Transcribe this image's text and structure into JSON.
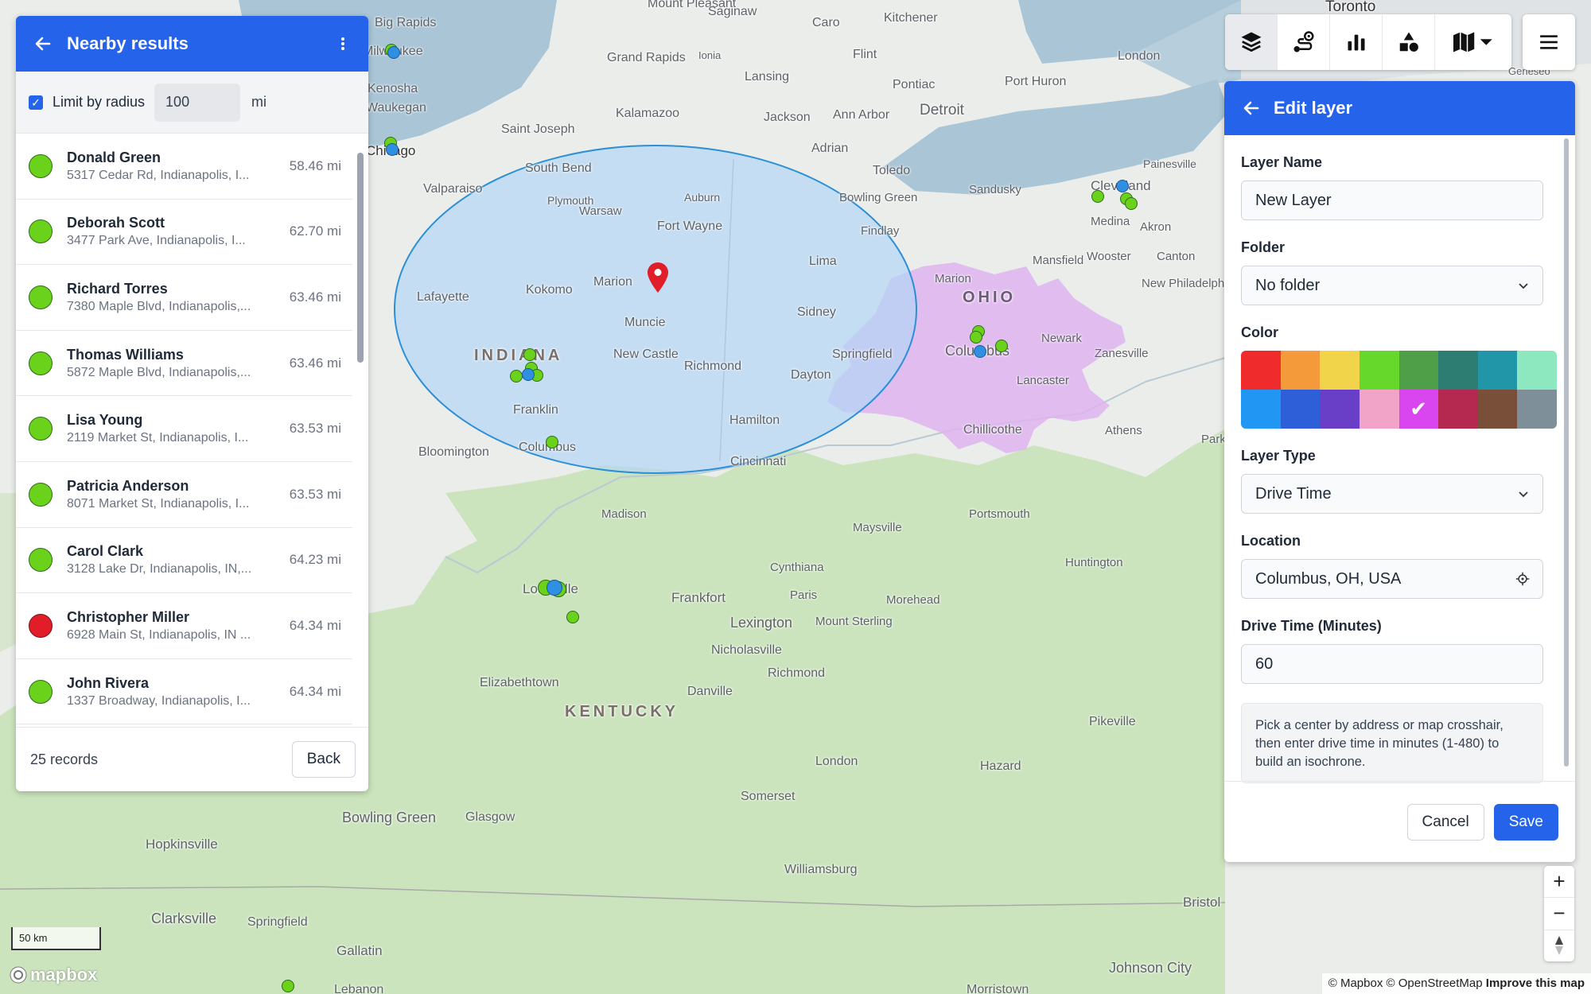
{
  "colors": {
    "accent": "#2563eb",
    "status_ok": "#6ad21b",
    "status_bad": "#e11d2a",
    "radius_fill": "#b3d6f5",
    "isochrone_fill": "#dfb3f0"
  },
  "map": {
    "places": [
      "Big Rapids",
      "Mount Pleasant",
      "Saginaw",
      "Caro",
      "Kitchener",
      "Toronto",
      "Milwaukee",
      "Grand Rapids",
      "Ionia",
      "Flint",
      "London",
      "Port Huron",
      "Lansing",
      "Pontiac",
      "Kenosha",
      "Waukegan",
      "Detroit",
      "Kalamazoo",
      "Jackson",
      "Ann Arbor",
      "Saint Joseph",
      "Adrian",
      "Chicago",
      "South Bend",
      "Toledo",
      "Painesville",
      "Valparaiso",
      "Plymouth",
      "Auburn",
      "Bowling Green",
      "Sandusky",
      "Cleveland",
      "Warsaw",
      "Fort Wayne",
      "Findlay",
      "Medina",
      "Akron",
      "Lima",
      "Mansfield",
      "Wooster",
      "Canton",
      "Marion",
      "New Philadelphia",
      "Lafayette",
      "Kokomo",
      "Marion",
      "Sidney",
      "Muncie",
      "Newark",
      "Zanesville",
      "New Castle",
      "Springfield",
      "Columbus",
      "Richmond",
      "Dayton",
      "Lancaster",
      "Franklin",
      "Hamilton",
      "Chillicothe",
      "Athens",
      "Parkersburg",
      "Bloomington",
      "Columbus",
      "Cincinnati",
      "Madison",
      "Maysville",
      "Portsmouth",
      "Huntington",
      "Cynthiana",
      "Louisville",
      "Frankfort",
      "Paris",
      "Morehead",
      "Lexington",
      "Mount Sterling",
      "Nicholasville",
      "Richmond",
      "Elizabethtown",
      "Danville",
      "Pikeville",
      "Hazard",
      "London",
      "Somerset",
      "Bowling Green",
      "Glasgow",
      "Hopkinsville",
      "Williamsburg",
      "Bristol",
      "Clarksville",
      "Springfield",
      "Gallatin",
      "Johnson City",
      "Lebanon",
      "Morristown",
      "Geneseo"
    ],
    "state_labels": [
      "INDIANA",
      "OHIO",
      "KENTUCKY"
    ],
    "scale_label": "50 km",
    "logo_text": "mapbox",
    "attribution_1": "© Mapbox",
    "attribution_2": "© OpenStreetMap",
    "attribution_3": "Improve this map"
  },
  "toolbar": {
    "tools": [
      "layers-icon",
      "route-icon",
      "bar-chart-icon",
      "shapes-icon",
      "map-style-icon"
    ],
    "menu": "hamburger-icon"
  },
  "nearby": {
    "title": "Nearby results",
    "limit_label": "Limit by radius",
    "radius_value": "100",
    "radius_unit": "mi",
    "records": [
      {
        "name": "Donald Green",
        "address": "5317 Cedar Rd, Indianapolis, I...",
        "distance": "58.46 mi",
        "status": "ok"
      },
      {
        "name": "Deborah Scott",
        "address": "3477 Park Ave, Indianapolis, I...",
        "distance": "62.70 mi",
        "status": "ok"
      },
      {
        "name": "Richard Torres",
        "address": "7380 Maple Blvd, Indianapolis,...",
        "distance": "63.46 mi",
        "status": "ok"
      },
      {
        "name": "Thomas Williams",
        "address": "5872 Maple Blvd, Indianapolis,...",
        "distance": "63.46 mi",
        "status": "ok"
      },
      {
        "name": "Lisa Young",
        "address": "2119 Market St, Indianapolis, I...",
        "distance": "63.53 mi",
        "status": "ok"
      },
      {
        "name": "Patricia Anderson",
        "address": "8071 Market St, Indianapolis, I...",
        "distance": "63.53 mi",
        "status": "ok"
      },
      {
        "name": "Carol Clark",
        "address": "3128 Lake Dr, Indianapolis, IN,...",
        "distance": "64.23 mi",
        "status": "ok"
      },
      {
        "name": "Christopher Miller",
        "address": "6928 Main St, Indianapolis, IN ...",
        "distance": "64.34 mi",
        "status": "bad"
      },
      {
        "name": "John Rivera",
        "address": "1337 Broadway, Indianapolis, I...",
        "distance": "64.34 mi",
        "status": "ok"
      }
    ],
    "record_count": "25 records",
    "back_label": "Back"
  },
  "edit_layer": {
    "title": "Edit layer",
    "layer_name_label": "Layer Name",
    "layer_name_value": "New Layer",
    "folder_label": "Folder",
    "folder_value": "No folder",
    "color_label": "Color",
    "swatches": [
      "#ef2b2b",
      "#f59a3b",
      "#f2d44a",
      "#66d72b",
      "#4f9e48",
      "#2e7d72",
      "#2196a8",
      "#8ee8bf",
      "#2196f3",
      "#2f5fd8",
      "#6a3fc7",
      "#f2a3c8",
      "#d946ef",
      "#b5284f",
      "#7a4f3a",
      "#7f8f9a"
    ],
    "selected_swatch": "#d946ef",
    "layer_type_label": "Layer Type",
    "layer_type_value": "Drive Time",
    "location_label": "Location",
    "location_value": "Columbus, OH, USA",
    "drive_time_label": "Drive Time (Minutes)",
    "drive_time_value": "60",
    "help_text": "Pick a center by address or map crosshair, then enter drive time in minutes (1-480) to build an isochrone.",
    "cancel_label": "Cancel",
    "save_label": "Save"
  },
  "zoom_controls": {
    "zoom_in": "+",
    "zoom_out": "−"
  }
}
